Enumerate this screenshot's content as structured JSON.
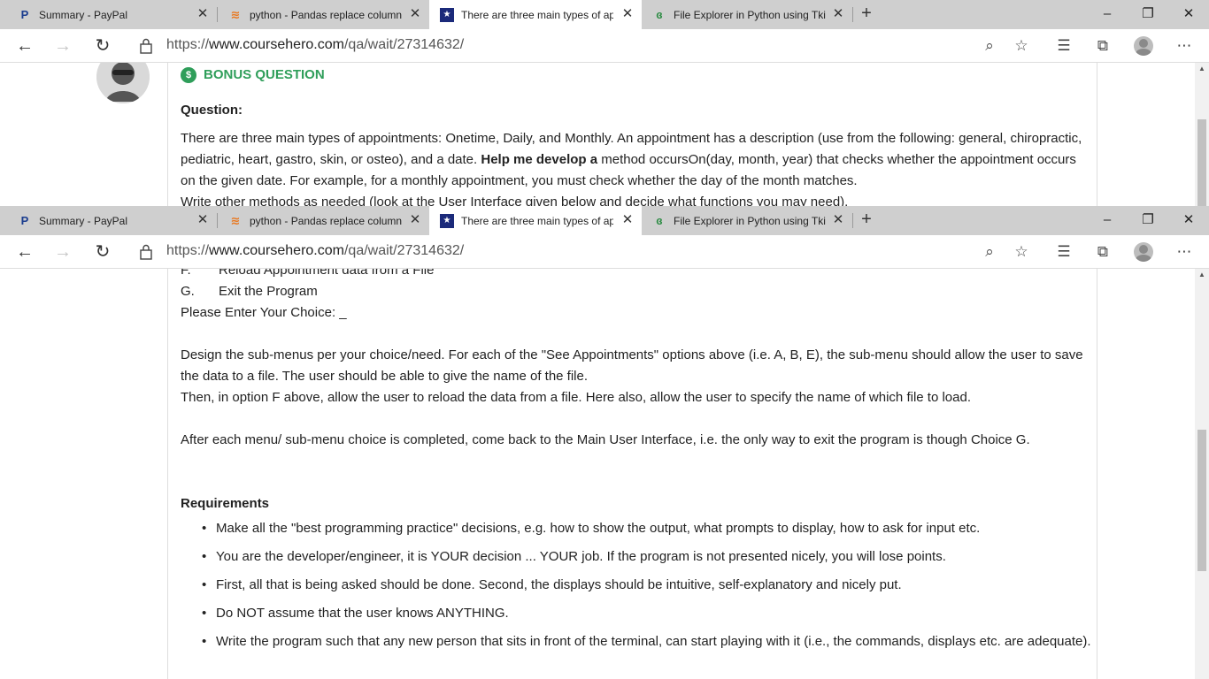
{
  "tabs": [
    {
      "title": "Summary - PayPal",
      "icon": "paypal-icon",
      "active": false
    },
    {
      "title": "python - Pandas replace column",
      "icon": "stackoverflow-icon",
      "active": false
    },
    {
      "title": "There are three main types of ap",
      "icon": "coursehero-icon",
      "active": true
    },
    {
      "title": "File Explorer in Python using Tkin",
      "icon": "geeksforgeeks-icon",
      "active": false
    }
  ],
  "address": {
    "protocol": "https://",
    "host": "www.coursehero.com",
    "path": "/qa/wait/27314632/"
  },
  "window_controls": {
    "minimize": "–",
    "restore": "❐",
    "close": "✕"
  },
  "question": {
    "bonus_label": "BONUS QUESTION",
    "question_label": "Question:",
    "para1_a": "There are three main types of appointments: Onetime, Daily, and Monthly. An appointment has a description (use from the following: general, chiropractic, pediatric, heart, gastro, skin, or osteo), and a date. ",
    "para1_bold": "Help me develop a",
    "para1_b": " method occursOn(day, month, year) that checks whether the appointment occurs on the given date. For example, for a monthly appointment, you must check whether the day of the month matches.",
    "para2": "Write other methods as needed (look at the User Interface given below and decide what functions you may need)."
  },
  "lower": {
    "menu_f_letter": "F.",
    "menu_f_text": "Reload Appointment data from a File",
    "menu_g_letter": "G.",
    "menu_g_text": "Exit the Program",
    "prompt": "Please Enter Your Choice: _",
    "design1": "Design the sub-menus per your choice/need. For each of the \"See Appointments\" options above (i.e. A, B, E), the sub-menu should allow the user to save the data to a file. The user should be able to give the name of the file.",
    "design2": "Then, in option F above, allow the user to reload the data from a file. Here also, allow the user to specify the name of which file to load.",
    "after": "After each menu/ sub-menu choice is completed, come back to the Main User Interface, i.e. the only way to exit the program is though Choice G.",
    "requirements_label": "Requirements",
    "requirements": [
      "Make all the \"best programming practice\" decisions, e.g. how to show the output, what prompts to display, how to ask for input etc.",
      "You are the developer/engineer, it is YOUR decision ... YOUR job. If the program is not presented nicely, you will lose points.",
      "First, all that is being asked should be done. Second, the displays should be intuitive, self-explanatory and nicely put.",
      "Do NOT assume that the user knows ANYTHING.",
      "Write the program such that any new person that sits in front of the terminal, can start playing with it (i.e., the commands, displays etc. are adequate)."
    ]
  },
  "colors": {
    "accent_green": "#2f9e5a",
    "tab_strip": "#cfcfcf"
  }
}
